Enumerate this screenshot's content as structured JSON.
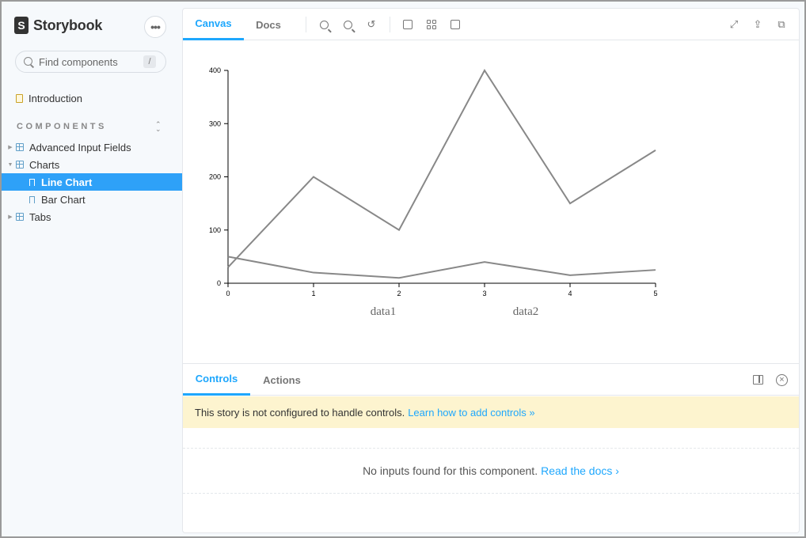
{
  "sidebar": {
    "brand": "Storybook",
    "menu_icon": "ellipsis-icon",
    "search": {
      "placeholder": "Find components",
      "shortcut": "/"
    },
    "intro": "Introduction",
    "section_label": "COMPONENTS",
    "items": [
      {
        "label": "Advanced Input Fields",
        "type": "group",
        "expanded": false
      },
      {
        "label": "Charts",
        "type": "group",
        "expanded": true
      },
      {
        "label": "Line Chart",
        "type": "story",
        "selected": true
      },
      {
        "label": "Bar Chart",
        "type": "story",
        "selected": false
      },
      {
        "label": "Tabs",
        "type": "group",
        "expanded": false
      }
    ]
  },
  "toolbar": {
    "tabs": [
      "Canvas",
      "Docs"
    ],
    "active_tab": "Canvas"
  },
  "addons": {
    "tabs": [
      "Controls",
      "Actions"
    ],
    "active_tab": "Controls",
    "notice_text": "This story is not configured to handle controls.",
    "notice_link": "Learn how to add controls »",
    "empty_text": "No inputs found for this component.",
    "empty_link": "Read the docs ›"
  },
  "colors": {
    "accent": "#1ea7fd",
    "selected_bg": "#2ea1f8",
    "notice_bg": "#fdf4cf",
    "line": "#888888"
  },
  "chart_data": {
    "type": "line",
    "x": [
      0,
      1,
      2,
      3,
      4,
      5
    ],
    "series": [
      {
        "name": "data1",
        "values": [
          30,
          200,
          100,
          400,
          150,
          250
        ]
      },
      {
        "name": "data2",
        "values": [
          50,
          20,
          10,
          40,
          15,
          25
        ]
      }
    ],
    "ylim": [
      0,
      400
    ],
    "y_ticks": [
      0,
      100,
      200,
      300,
      400
    ],
    "x_ticks": [
      0,
      1,
      2,
      3,
      4,
      5
    ],
    "legend": "bottom",
    "grid": false
  }
}
